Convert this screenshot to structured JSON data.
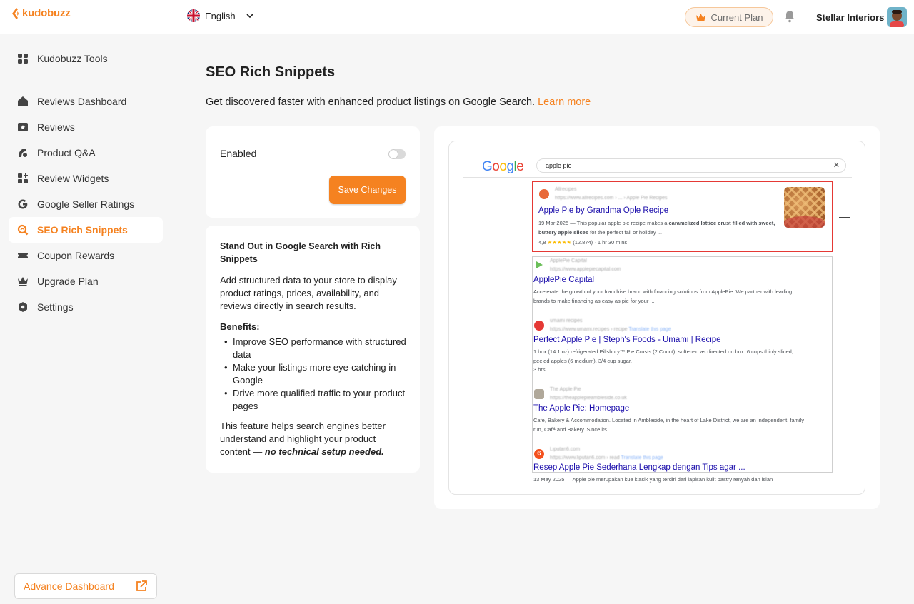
{
  "brand": {
    "name": "kudobuzz",
    "accent": "#f58220"
  },
  "header": {
    "language": "English",
    "plan_button": "Current Plan",
    "store_name": "Stellar Interiors"
  },
  "sidebar": {
    "items": [
      {
        "label": "Kudobuzz Tools",
        "icon": "grid-icon"
      },
      {
        "label": "Reviews Dashboard",
        "icon": "home-icon"
      },
      {
        "label": "Reviews",
        "icon": "star-box-icon"
      },
      {
        "label": "Product Q&A",
        "icon": "qa-icon"
      },
      {
        "label": "Review Widgets",
        "icon": "widgets-icon"
      },
      {
        "label": "Google Seller Ratings",
        "icon": "google-icon"
      },
      {
        "label": "SEO Rich Snippets",
        "icon": "seo-icon",
        "active": true
      },
      {
        "label": "Coupon Rewards",
        "icon": "ticket-icon"
      },
      {
        "label": "Upgrade Plan",
        "icon": "crown-icon"
      },
      {
        "label": "Settings",
        "icon": "gear-icon"
      }
    ],
    "advance_button": "Advance Dashboard"
  },
  "main": {
    "title": "SEO Rich Snippets",
    "subtitle": "Get discovered faster with enhanced product listings on Google Search.",
    "learn_more": "Learn more",
    "settings_card": {
      "enabled_label": "Enabled",
      "enabled": false,
      "save_button": "Save Changes"
    },
    "info_card": {
      "heading": "Stand Out in Google Search with Rich Snippets",
      "intro": "Add structured data to your store to display product ratings, prices, availability, and reviews directly in search results.",
      "benefits_heading": "Benefits:",
      "benefits": [
        "Improve SEO performance with structured data",
        "Make your listings more eye-catching in Google",
        "Drive more qualified traffic to your product pages"
      ],
      "outro": "This feature helps search engines better understand and highlight your product content —",
      "outro_emphasis": "no technical setup needed."
    }
  },
  "serp_preview": {
    "logo": "Google",
    "query": "apple pie",
    "results": [
      {
        "site": "Allrecipes",
        "url": "https://www.allrecipes.com › ... › Apple Pie Recipes",
        "title": "Apple Pie by Grandma Ople Recipe",
        "desc_date": "19 Mar 2025",
        "desc_start": "This popular apple pie recipe makes a",
        "desc_bold": "caramelized lattice crust filled with sweet, buttery apple slices",
        "desc_end": "for the perfect fall or holiday ...",
        "rating": "4,8",
        "stars": "★★★★★",
        "reviews": "(12.874)",
        "time": "1 hr 30 mins"
      },
      {
        "site": "ApplePie Capital",
        "url": "https://www.applepiecapital.com",
        "title": "ApplePie Capital",
        "desc": "Accelerate the growth of your franchise brand with financing solutions from ApplePie. We partner with leading brands to make financing as easy as pie for your ..."
      },
      {
        "site": "umami recipes",
        "url": "https://www.umami.recipes › recipe",
        "translate": "Translate this page",
        "title": "Perfect Apple Pie | Steph's Foods - Umami | Recipe",
        "desc": "1 box (14.1 oz) refrigerated Pillsbury™ Pie Crusts (2 Count), softened as directed on box. 6 cups thinly sliced, peeled apples (6 medium). 3/4 cup sugar.",
        "time": "3 hrs"
      },
      {
        "site": "The Apple Pie",
        "url": "https://theapplepieambleside.co.uk",
        "title": "The Apple Pie: Homepage",
        "desc": "Cafe, Bakery & Accommodation. Located in Ambleside, in the heart of Lake District, we are an independent, family run, Café and Bakery. Since its ..."
      },
      {
        "site": "Liputan6.com",
        "url": "https://www.liputan6.com › read",
        "translate": "Translate this page",
        "title": "Resep Apple Pie Sederhana Lengkap dengan Tips agar ...",
        "desc": "13 May 2025 — Apple pie merupakan kue klasik yang terdiri dari lapisan kulit pastry renyah dan isian"
      }
    ]
  }
}
